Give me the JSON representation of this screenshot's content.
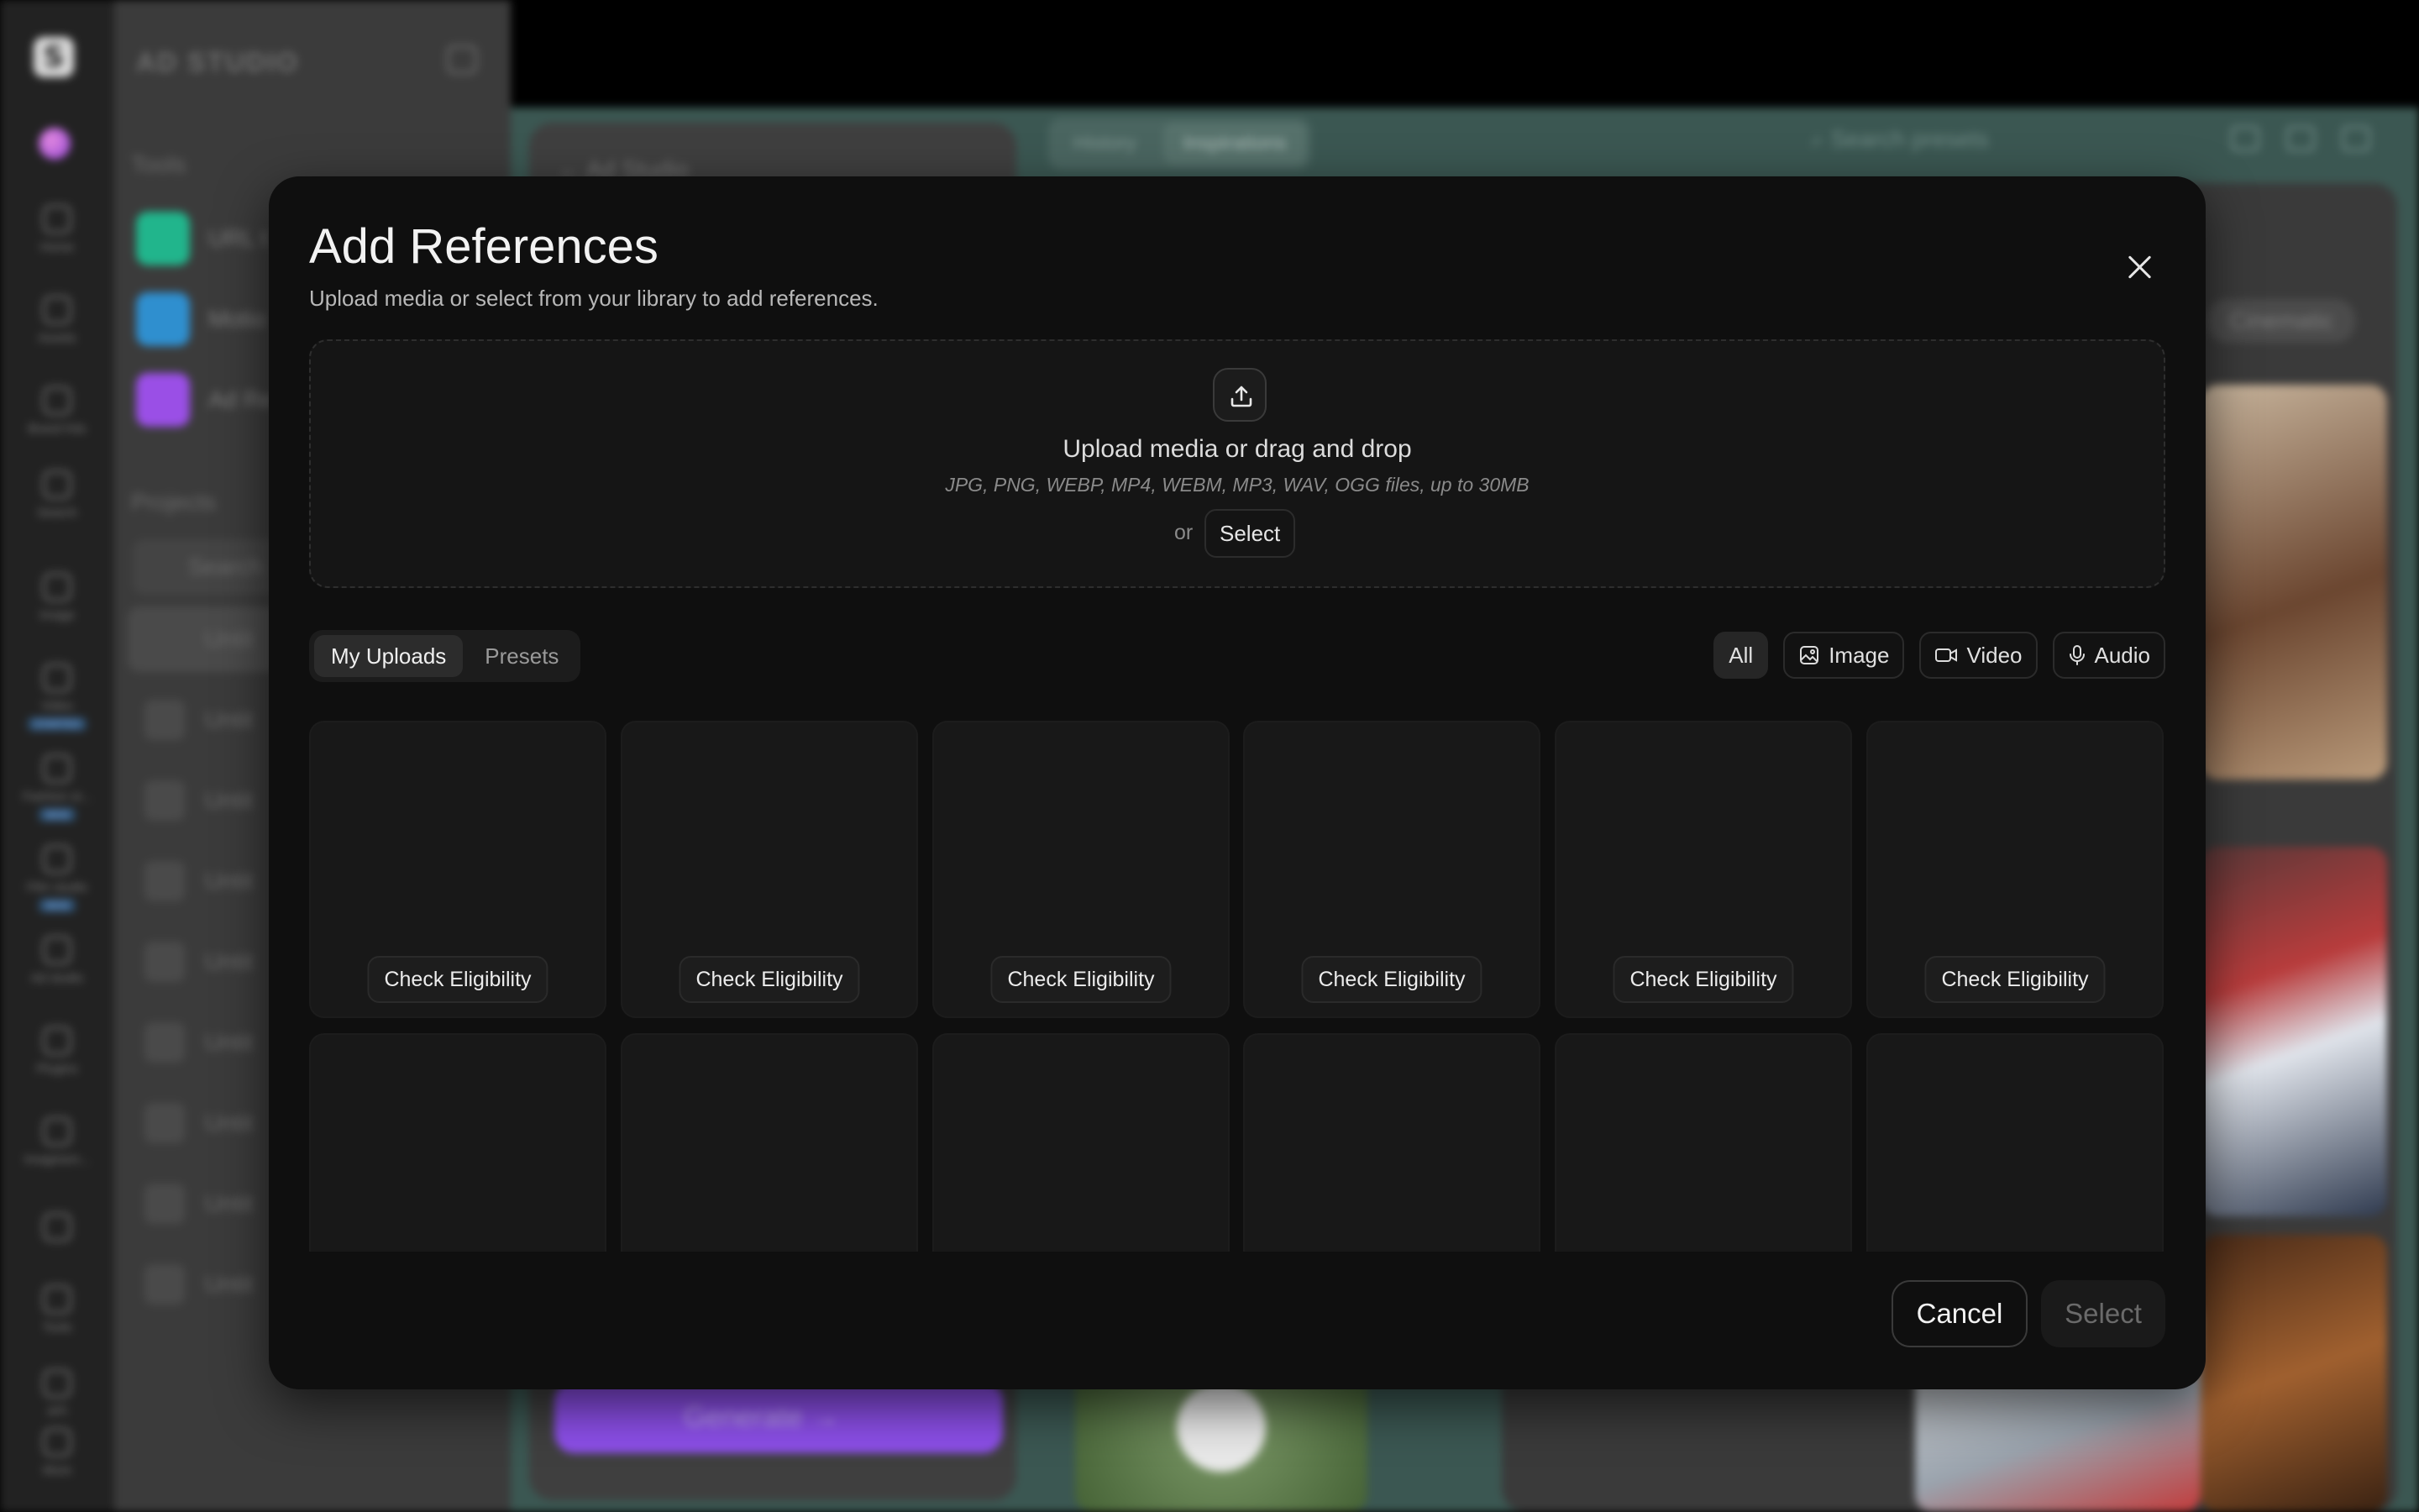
{
  "background": {
    "brand": "AD STUDIO",
    "rail_items": [
      {
        "label": "Home",
        "icon": "home-icon"
      },
      {
        "label": "Assets",
        "icon": "assets-icon"
      },
      {
        "label": "Brand Kits",
        "icon": "brand-kits-icon"
      },
      {
        "label": "Search",
        "icon": "search-icon"
      },
      {
        "label": "Image",
        "icon": "image-icon"
      },
      {
        "label": "Video",
        "icon": "video-icon",
        "badge": "STARTED"
      },
      {
        "label": "Fashion st...",
        "icon": "fashion-icon",
        "badge": "NEW"
      },
      {
        "label": "Film studio",
        "icon": "film-icon",
        "badge": "NEW"
      },
      {
        "label": "Ad studio",
        "icon": "ad-studio-icon"
      },
      {
        "label": "Plugins",
        "icon": "plugins-icon"
      },
      {
        "label": "Imaginem...",
        "icon": "imagine-icon"
      },
      {
        "label": "",
        "icon": "chart-icon"
      },
      {
        "label": "Tools",
        "icon": "tools-icon"
      },
      {
        "label": "API",
        "icon": "api-icon"
      },
      {
        "label": "More",
        "icon": "more-icon"
      }
    ],
    "tools_heading": "Tools",
    "tools": [
      {
        "label": "URL t",
        "color": "#21b58c"
      },
      {
        "label": "Motio",
        "color": "#2f8fcf"
      },
      {
        "label": "Ad Re",
        "color": "#9a4fe6"
      }
    ],
    "projects_heading": "Projects",
    "project_search_placeholder": "Search",
    "projects": [
      "Untit",
      "Untit",
      "Untit",
      "Untit",
      "Untit",
      "Untit",
      "Untit",
      "Untit",
      "Untit"
    ],
    "card_back": "Ad Studio",
    "generate_label": "Generate →",
    "tabs": [
      "History",
      "Inspirations"
    ],
    "active_tab": "Inspirations",
    "preset_search": "Search presets",
    "chip": "Cinematic"
  },
  "modal": {
    "title": "Add References",
    "subtitle": "Upload media or select from your library to add references.",
    "dropzone": {
      "title": "Upload media or drag and drop",
      "types": "JPG, PNG, WEBP, MP4, WEBM, MP3, WAV, OGG files, up to 30MB",
      "or": "or",
      "select": "Select"
    },
    "source_tabs": [
      {
        "label": "My Uploads",
        "active": true
      },
      {
        "label": "Presets",
        "active": false
      }
    ],
    "filters": [
      {
        "label": "All",
        "icon": "",
        "active": true
      },
      {
        "label": "Image",
        "icon": "image-icon",
        "active": false
      },
      {
        "label": "Video",
        "icon": "video-icon",
        "active": false
      },
      {
        "label": "Audio",
        "icon": "microphone-icon",
        "active": false
      }
    ],
    "tiles_row1": [
      "Check Eligibility",
      "Check Eligibility",
      "Check Eligibility",
      "Check Eligibility",
      "Check Eligibility",
      "Check Eligibility"
    ],
    "footer": {
      "cancel": "Cancel",
      "select": "Select"
    }
  }
}
